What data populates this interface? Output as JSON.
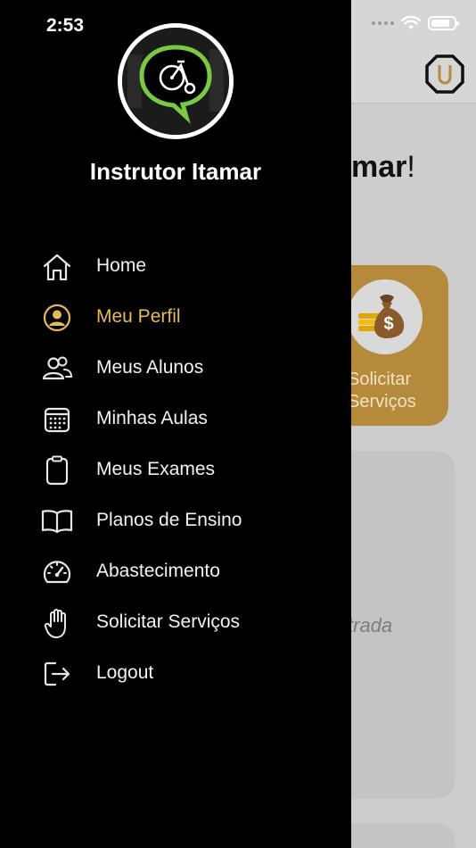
{
  "status_bar": {
    "time": "2:53"
  },
  "background": {
    "greeting_tail": "mar",
    "greeting_punct": "!",
    "service_card_label": "Solicitar Serviços",
    "panel_text": "trada"
  },
  "drawer": {
    "profile_name": "Instrutor Itamar",
    "items": [
      {
        "label": "Home",
        "icon": "home-icon",
        "active": false
      },
      {
        "label": "Meu Perfil",
        "icon": "user-circle-icon",
        "active": true
      },
      {
        "label": "Meus Alunos",
        "icon": "users-icon",
        "active": false
      },
      {
        "label": "Minhas Aulas",
        "icon": "calendar-icon",
        "active": false
      },
      {
        "label": "Meus Exames",
        "icon": "clipboard-icon",
        "active": false
      },
      {
        "label": "Planos de Ensino",
        "icon": "book-icon",
        "active": false
      },
      {
        "label": "Abastecimento",
        "icon": "gauge-icon",
        "active": false
      },
      {
        "label": "Solicitar Serviços",
        "icon": "hand-icon",
        "active": false
      },
      {
        "label": "Logout",
        "icon": "logout-icon",
        "active": false
      }
    ]
  },
  "colors": {
    "drawer_bg": "#000000",
    "active_item": "#e9b955",
    "accent_gold": "#b58a3a",
    "logo_green": "#7ac943"
  }
}
